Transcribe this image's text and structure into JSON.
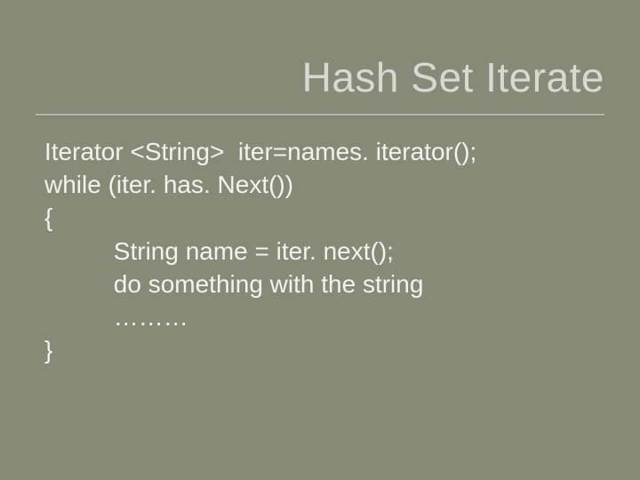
{
  "slide": {
    "title": "Hash Set Iterate",
    "code": {
      "l1": "Iterator <String>  iter=names. iterator();",
      "l2": "while (iter. has. Next())",
      "l3": "{",
      "l4": "          String name = iter. next();",
      "l5": "          do something with the string",
      "l6": "          ………",
      "l7": "}"
    }
  }
}
